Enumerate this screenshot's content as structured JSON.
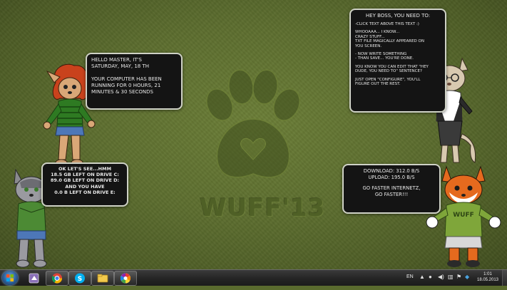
{
  "bubbles": {
    "master": {
      "line1": "HELLO MASTER, IT'S",
      "line2": "SATURDAY, MAY, 18 TH",
      "line3": "YOUR COMPUTER HAS BEEN",
      "line4": "RUNNING FOR  0 HOURS, 21",
      "line5": "MINUTES & 30 SECONDS"
    },
    "boss": {
      "title": "HEY BOSS, YOU NEED TO:",
      "l1": "-CLICK TEXT ABOVE THIS TEXT :)",
      "l2": "WHOOAAA... I KNOW...",
      "l3": "CRAZY STUFF...",
      "l4": "TXT FILE MAGICALLY APPEARED ON",
      "l5": "YOU SCREEN.",
      "l6": "- NOW WRITE SOMETHING",
      "l7": "- THAN SAVE... YOU'RE DONE.",
      "l8": "YOU KNOW YOU CAN EDIT THAT \"HEY",
      "l9": "DUDE, YOU NEED TO\" SENTENCE?",
      "l10": "JUST OPEN \"CONFIGURE\", YOU'LL",
      "l11": "FIGURE OUT THE REST."
    },
    "drives": {
      "l1": "OK LET'S SEE...HMM",
      "l2": "18.5 GB LEFT ON DRIVE C:",
      "l3": "89.0 GB LEFT ON DRIVE D:",
      "l4": "AND YOU HAVE",
      "l5": "0.0 B LEFT ON DRIVE E:"
    },
    "network": {
      "download": "DOWNLOAD: 312.0 B/S",
      "upload": "UPLOAD: 195.0 B/S",
      "l1": "GO FASTER INTERNETZ,",
      "l2": "GO FASTER!!!"
    }
  },
  "logo": {
    "text": "WUFF'13"
  },
  "mascot_shirt_text": "WUFF",
  "taskbar": {
    "pinned_icons": [
      "start-orb",
      "program-icon",
      "chrome-icon",
      "skype-icon",
      "explorer-icon",
      "picasa-icon"
    ],
    "language": "EN",
    "time": "1:01",
    "date": "18.05.2013"
  },
  "colors": {
    "background": "#5d6e2f",
    "bubble_bg": "#141414",
    "bubble_border": "#cfd2c6",
    "bubble_text": "#e8e8e8"
  }
}
